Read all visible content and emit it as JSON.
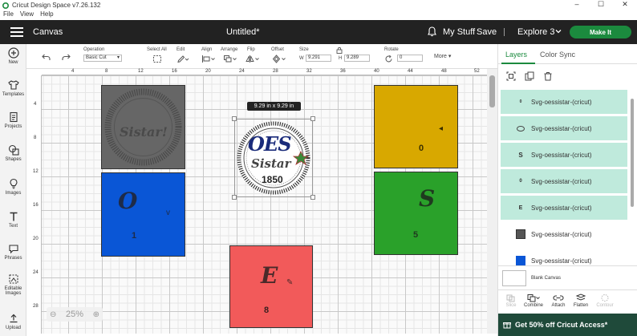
{
  "window": {
    "title": "Cricut Design Space  v7.26.132",
    "controls": [
      "–",
      "☐",
      "✕"
    ]
  },
  "menu": [
    "File",
    "View",
    "Help"
  ],
  "header": {
    "section": "Canvas",
    "document_title": "Untitled*",
    "my_stuff": "My Stuff",
    "save": "Save",
    "machine": "Explore 3",
    "make_it": "Make It"
  },
  "left_toolbar": [
    {
      "label": "New",
      "icon": "plus-circle-icon"
    },
    {
      "label": "Templates",
      "icon": "shirt-icon"
    },
    {
      "label": "Projects",
      "icon": "projects-icon"
    },
    {
      "label": "Shapes",
      "icon": "shapes-icon"
    },
    {
      "label": "Images",
      "icon": "bulb-icon"
    },
    {
      "label": "Text",
      "icon": "text-icon"
    },
    {
      "label": "Phrases",
      "icon": "chat-icon"
    },
    {
      "label": "Editable Images",
      "icon": "editable-images-icon"
    },
    {
      "label": "Upload",
      "icon": "upload-icon"
    }
  ],
  "edit_toolbar": {
    "operation_label": "Operation",
    "operation_value": "Basic Cut",
    "select_all": "Select All",
    "edit": "Edit",
    "align": "Align",
    "arrange": "Arrange",
    "flip": "Flip",
    "offset": "Offset",
    "size": "Size",
    "size_w_label": "W",
    "size_w": "9.291",
    "size_h_label": "H",
    "size_h": "9.289",
    "rotate": "Rotate",
    "rotate_value": "0",
    "more": "More"
  },
  "ruler": {
    "top": [
      "4",
      "8",
      "12",
      "16",
      "20",
      "24",
      "28",
      "32",
      "36",
      "40",
      "44",
      "48",
      "52"
    ],
    "left": [
      "4",
      "8",
      "12",
      "16",
      "20",
      "24",
      "28"
    ]
  },
  "canvas": {
    "size_badge": "9.29  in x 9.29  in",
    "zoom": "25%",
    "tiles": [
      {
        "name": "tile-sistar-gray",
        "color": "#666666",
        "text": "Sistar!"
      },
      {
        "name": "tile-o-blue",
        "color": "#0a56d6",
        "letter": "O",
        "number": "1"
      },
      {
        "name": "tile-e-red",
        "color": "#f25a5a",
        "letter": "E",
        "number": "8"
      },
      {
        "name": "tile-o-yellow",
        "color": "#d8a800",
        "letter": "",
        "number": "0"
      },
      {
        "name": "tile-s-green",
        "color": "#2aa12a",
        "letter": "S",
        "number": "5"
      }
    ],
    "logo": {
      "line1": "OES",
      "line2": "Sistar",
      "line3": "1850"
    }
  },
  "right_panel": {
    "tabs": [
      "Layers",
      "Color Sync"
    ],
    "layers": [
      {
        "label": "Svg-oessistar-(cricut)",
        "thumb": "0",
        "selected": true
      },
      {
        "label": "Svg-oessistar-(cricut)",
        "thumb": "O",
        "selected": true
      },
      {
        "label": "Svg-oessistar-(cricut)",
        "thumb": "S",
        "selected": true
      },
      {
        "label": "Svg-oessistar-(cricut)",
        "thumb": "0",
        "selected": true
      },
      {
        "label": "Svg-oessistar-(cricut)",
        "thumb": "E",
        "selected": true
      },
      {
        "label": "Svg-oessistar-(cricut)",
        "thumb": "",
        "selected": false
      },
      {
        "label": "Svg-oessistar-(cricut)",
        "thumb": "",
        "selected": false
      }
    ],
    "blank_canvas": "Blank Canvas",
    "tools": [
      {
        "label": "Slice",
        "disabled": true
      },
      {
        "label": "Combine",
        "disabled": false
      },
      {
        "label": "Attach",
        "disabled": false
      },
      {
        "label": "Flatten",
        "disabled": false
      },
      {
        "label": "Contour",
        "disabled": true
      }
    ],
    "promo": "Get 50% off Cricut Access*"
  },
  "colors": {
    "accent": "#1b8a3e",
    "header_bg": "#222222",
    "layer_selected": "#bfeadc",
    "promo_bg": "#1f4a3a"
  }
}
